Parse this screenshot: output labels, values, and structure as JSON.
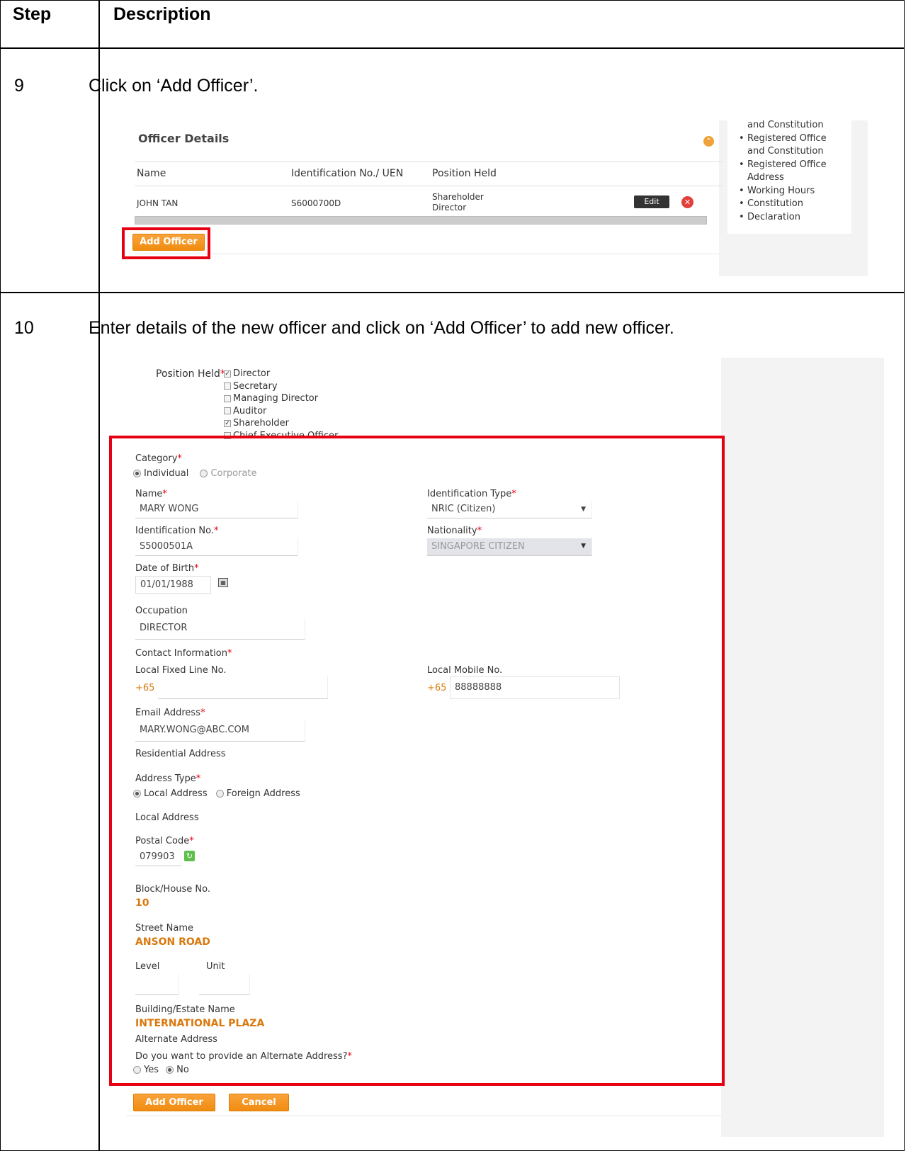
{
  "table": {
    "header_step": "Step",
    "header_description": "Description",
    "rows": [
      {
        "step": "9",
        "description": "Click on ‘Add Officer’."
      },
      {
        "step": "10",
        "description": "Enter details of the new officer and click on ‘Add Officer’ to add new officer."
      }
    ]
  },
  "shot1": {
    "title": "Officer Details",
    "columns": [
      "Name",
      "Identification No./ UEN",
      "Position Held"
    ],
    "row": {
      "name": "JOHN TAN",
      "id": "S6000700D",
      "position_1": "Shareholder",
      "position_2": "Director"
    },
    "edit_label": "Edit",
    "add_label": "Add Officer",
    "side_items": [
      "and Constitution",
      "Registered Office",
      "and Constitution",
      "Registered Office",
      "Address",
      "Working Hours",
      "Constitution",
      "Declaration"
    ]
  },
  "shot2": {
    "position_label": "Position Held",
    "positions": [
      {
        "label": "Director",
        "checked": true
      },
      {
        "label": "Secretary",
        "checked": false
      },
      {
        "label": "Managing Director",
        "checked": false
      },
      {
        "label": "Auditor",
        "checked": false
      },
      {
        "label": "Shareholder",
        "checked": true
      },
      {
        "label": "Chief Executive Officer",
        "checked": false
      }
    ],
    "category_label": "Category",
    "category_individual": "Individual",
    "category_corporate": "Corporate",
    "name_label": "Name",
    "name_value": "MARY WONG",
    "id_type_label": "Identification Type",
    "id_type_value": "NRIC (Citizen)",
    "id_no_label": "Identification No.",
    "id_no_value": "S5000501A",
    "nationality_label": "Nationality",
    "nationality_value": "SINGAPORE CITIZEN",
    "dob_label": "Date of Birth",
    "dob_value": "01/01/1988",
    "occupation_label": "Occupation",
    "occupation_value": "DIRECTOR",
    "contact_label": "Contact Information",
    "fixed_label": "Local Fixed Line No.",
    "fixed_prefix": "+65",
    "mobile_label": "Local Mobile No.",
    "mobile_prefix": "+65",
    "mobile_value": "88888888",
    "email_label": "Email Address",
    "email_value": "MARY.WONG@ABC.COM",
    "residential_label": "Residential Address",
    "address_type_label": "Address Type",
    "address_local": "Local Address",
    "address_foreign": "Foreign Address",
    "local_address_label": "Local Address",
    "postal_label": "Postal Code",
    "postal_value": "079903",
    "block_label": "Block/House No.",
    "block_value": "10",
    "street_label": "Street Name",
    "street_value": "ANSON ROAD",
    "level_label": "Level",
    "unit_label": "Unit",
    "building_label": "Building/Estate Name",
    "building_value": "INTERNATIONAL PLAZA",
    "alternate_label": "Alternate Address",
    "alternate_question": "Do you want to provide an Alternate Address?",
    "alt_yes": "Yes",
    "alt_no": "No",
    "add_label": "Add Officer",
    "cancel_label": "Cancel"
  }
}
